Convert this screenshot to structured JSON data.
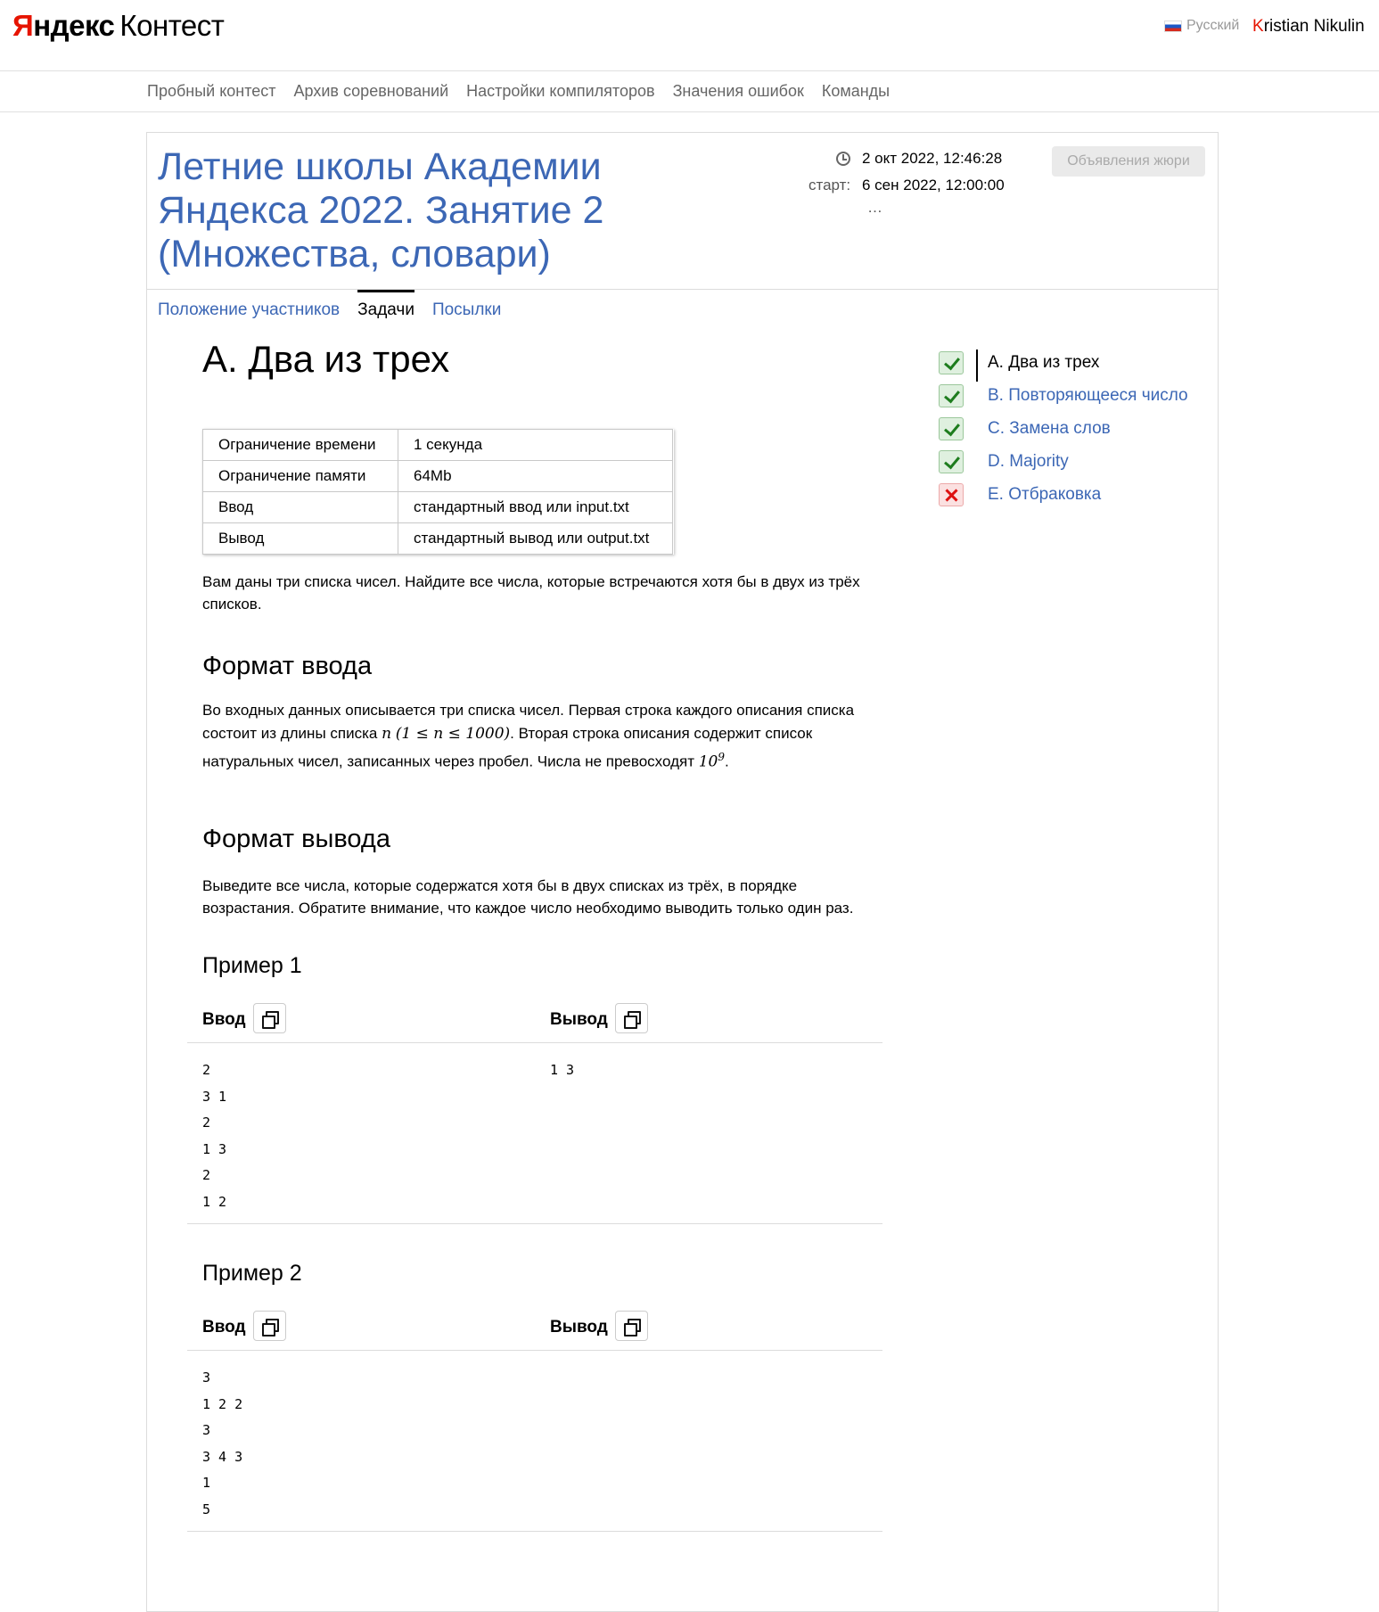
{
  "header": {
    "logo_ya": "Я",
    "logo_ya_rest": "ндекс",
    "logo_product": "Контест",
    "language": "Русский",
    "user_first": "K",
    "user_rest": "ristian Nikulin"
  },
  "nav": {
    "items": [
      "Пробный контест",
      "Архив соревнований",
      "Настройки компиляторов",
      "Значения ошибок",
      "Команды"
    ]
  },
  "contest": {
    "title": "Летние школы Академии Яндекса 2022. Занятие 2 (Множества, словари)",
    "current_time": "2 окт 2022, 12:46:28",
    "start_label": "старт:",
    "start_time": "6 сен 2022, 12:00:00",
    "more": "…",
    "jury_button": "Объявления жюри",
    "tabs": [
      "Положение участников",
      "Задачи",
      "Посылки"
    ],
    "active_tab": "Задачи"
  },
  "problem": {
    "title": "A. Два из трех",
    "limits": [
      {
        "label": "Ограничение времени",
        "value": "1 секунда"
      },
      {
        "label": "Ограничение памяти",
        "value": "64Mb"
      },
      {
        "label": "Ввод",
        "value": "стандартный ввод или input.txt"
      },
      {
        "label": "Вывод",
        "value": "стандартный вывод или output.txt"
      }
    ],
    "statement": "Вам даны три списка чисел. Найдите все числа, которые встречаются хотя бы в двух из трёх списков.",
    "input_heading": "Формат ввода",
    "input_text_1": "Во входных данных описывается три списка чисел. Первая строка каждого описания списка состоит из длины списка ",
    "input_math_n": "n",
    "input_math_range": "(1 ≤ n ≤ 1000)",
    "input_text_2": ". Вторая строка описания содержит список натуральных чисел, записанных через пробел. Числа не превосходят ",
    "input_math_base": "10",
    "input_math_exp": "9",
    "input_text_3": ".",
    "output_heading": "Формат вывода",
    "output_text": "Выведите все числа, которые содержатся хотя бы в двух списках из трёх, в порядке возрастания. Обратите внимание, что каждое число необходимо выводить только один раз.",
    "samples": [
      {
        "title": "Пример 1",
        "input_label": "Ввод",
        "output_label": "Вывод",
        "input": "2\n3 1\n2\n1 3\n2\n1 2",
        "output": "1 3"
      },
      {
        "title": "Пример 2",
        "input_label": "Ввод",
        "output_label": "Вывод",
        "input": "3\n1 2 2\n3\n3 4 3\n1\n5",
        "output": ""
      }
    ]
  },
  "problem_list": [
    {
      "name": "A. Два из трех",
      "status": "ok",
      "current": true
    },
    {
      "name": "B. Повторяющееся число",
      "status": "ok",
      "current": false
    },
    {
      "name": "C. Замена слов",
      "status": "ok",
      "current": false
    },
    {
      "name": "D. Majority",
      "status": "ok",
      "current": false
    },
    {
      "name": "E. Отбраковка",
      "status": "fail",
      "current": false
    }
  ],
  "colors": {
    "link": "#3c67b5",
    "brand_red": "#e61400",
    "ok": "#1e7d1e",
    "fail": "#dd1111"
  },
  "icons": {
    "clock": "clock-icon",
    "copy": "copy-icon",
    "ok": "checkmark-icon",
    "fail": "cross-icon",
    "flag": "russia-flag-icon"
  }
}
